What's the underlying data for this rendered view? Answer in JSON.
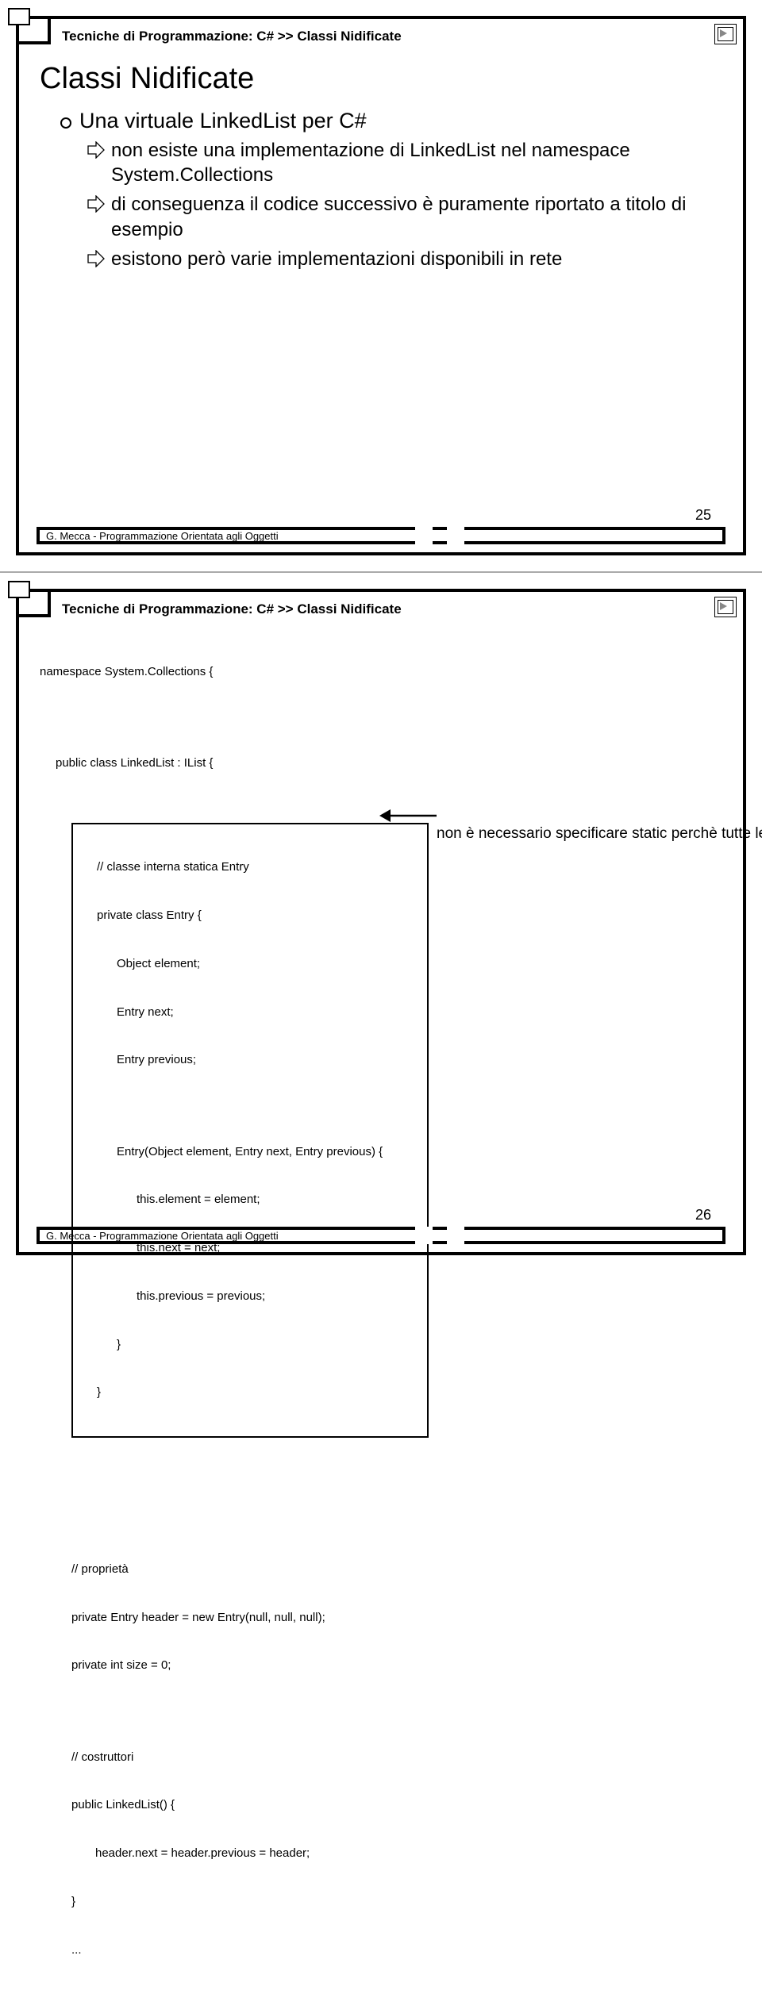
{
  "slide1": {
    "breadcrumb": "Tecniche di Programmazione: C# >> Classi Nidificate",
    "title": "Classi Nidificate",
    "point1": "Una virtuale LinkedList per C#",
    "arrow1": "non esiste una implementazione di LinkedList nel namespace System.Collections",
    "arrow2": "di conseguenza il codice successivo è puramente riportato a titolo di esempio",
    "arrow3": "esistono però varie implementazioni disponibili in rete",
    "footer": "G. Mecca - Programmazione Orientata agli Oggetti",
    "page": "25"
  },
  "slide2": {
    "breadcrumb": "Tecniche di Programmazione: C# >> Classi Nidificate",
    "ns": "namespace System.Collections {",
    "cls": "public class LinkedList : IList {",
    "box_comment": "// classe interna statica Entry",
    "box_l1": "private class Entry {",
    "box_l2": "Object element;",
    "box_l3": "Entry next;",
    "box_l4": "Entry previous;",
    "box_l5": "Entry(Object element, Entry next, Entry previous) {",
    "box_l6": "this.element = element;",
    "box_l7": "this.next = next;",
    "box_l8": "this.previous = previous;",
    "box_l9": "}",
    "box_l10": "}",
    "prop_comment": "// proprietà",
    "prop_l1": "private Entry header = new Entry(null, null, null);",
    "prop_l2": "private int size = 0;",
    "ctor_comment": "// costruttori",
    "ctor_l1": "public LinkedList() {",
    "ctor_l2": "header.next = header.previous = header;",
    "ctor_l3": "}",
    "ctor_l4": "...",
    "annotation": "non è necessario specificare static perchè tutte le classi interne sono automaticamente statiche",
    "footer": "G. Mecca - Programmazione Orientata agli Oggetti",
    "page": "26"
  }
}
